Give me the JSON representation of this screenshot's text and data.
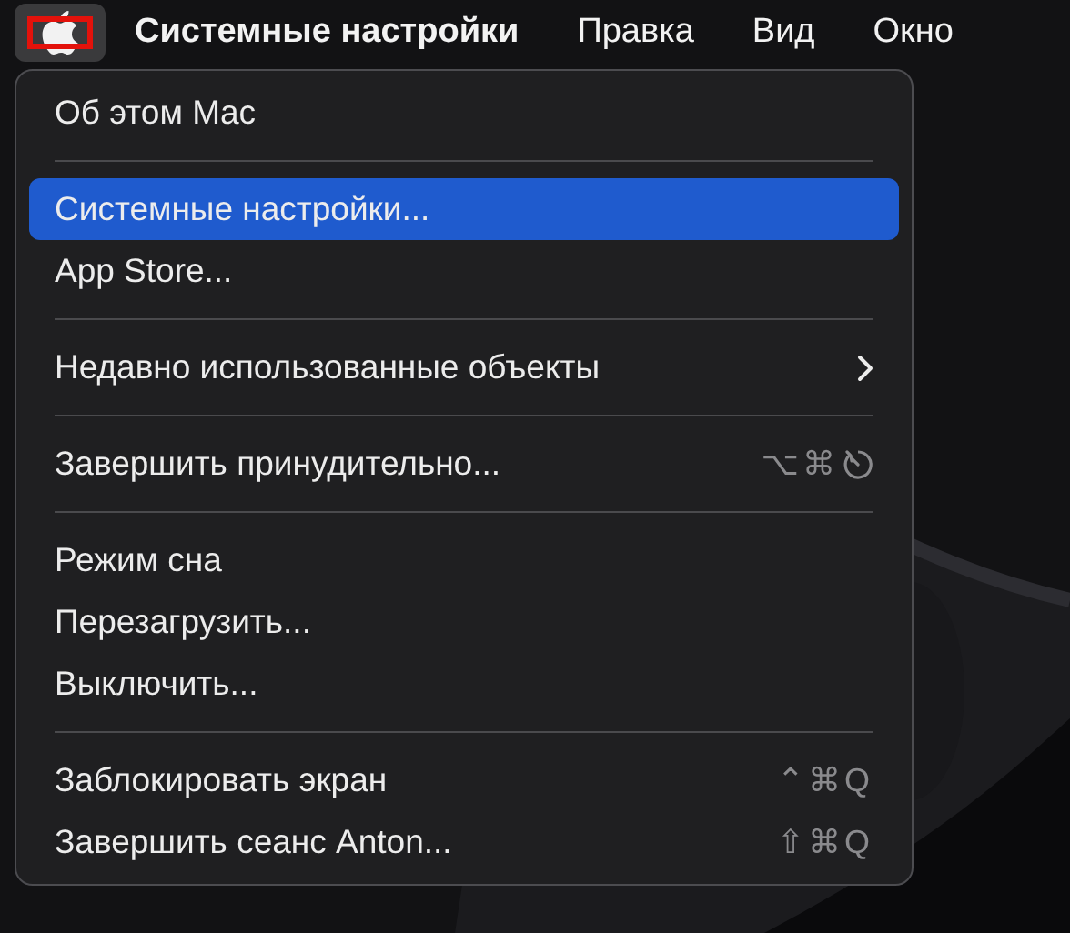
{
  "menu_bar": {
    "apple_highlighted": true,
    "items": [
      {
        "label": "Системные настройки",
        "bold": true
      },
      {
        "label": "Правка",
        "bold": false
      },
      {
        "label": "Вид",
        "bold": false
      },
      {
        "label": "Окно",
        "bold": false
      }
    ]
  },
  "menu": {
    "items": [
      {
        "kind": "item",
        "label": "Об этом Mac",
        "selected": false
      },
      {
        "kind": "separator"
      },
      {
        "kind": "item",
        "label": "Системные настройки...",
        "selected": true
      },
      {
        "kind": "item",
        "label": "App Store...",
        "selected": false
      },
      {
        "kind": "separator"
      },
      {
        "kind": "item",
        "label": "Недавно использованные объекты",
        "selected": false,
        "has_submenu": true
      },
      {
        "kind": "separator"
      },
      {
        "kind": "item",
        "label": "Завершить принудительно...",
        "selected": false,
        "shortcut": "⌥⌘",
        "restart_icon": true
      },
      {
        "kind": "separator"
      },
      {
        "kind": "item",
        "label": "Режим сна",
        "selected": false
      },
      {
        "kind": "item",
        "label": "Перезагрузить...",
        "selected": false
      },
      {
        "kind": "item",
        "label": "Выключить...",
        "selected": false
      },
      {
        "kind": "separator"
      },
      {
        "kind": "item",
        "label": "Заблокировать экран",
        "selected": false,
        "shortcut": "⌃⌘Q"
      },
      {
        "kind": "item",
        "label": "Завершить сеанс Anton...",
        "selected": false,
        "shortcut": "⇧⌘Q"
      }
    ]
  }
}
